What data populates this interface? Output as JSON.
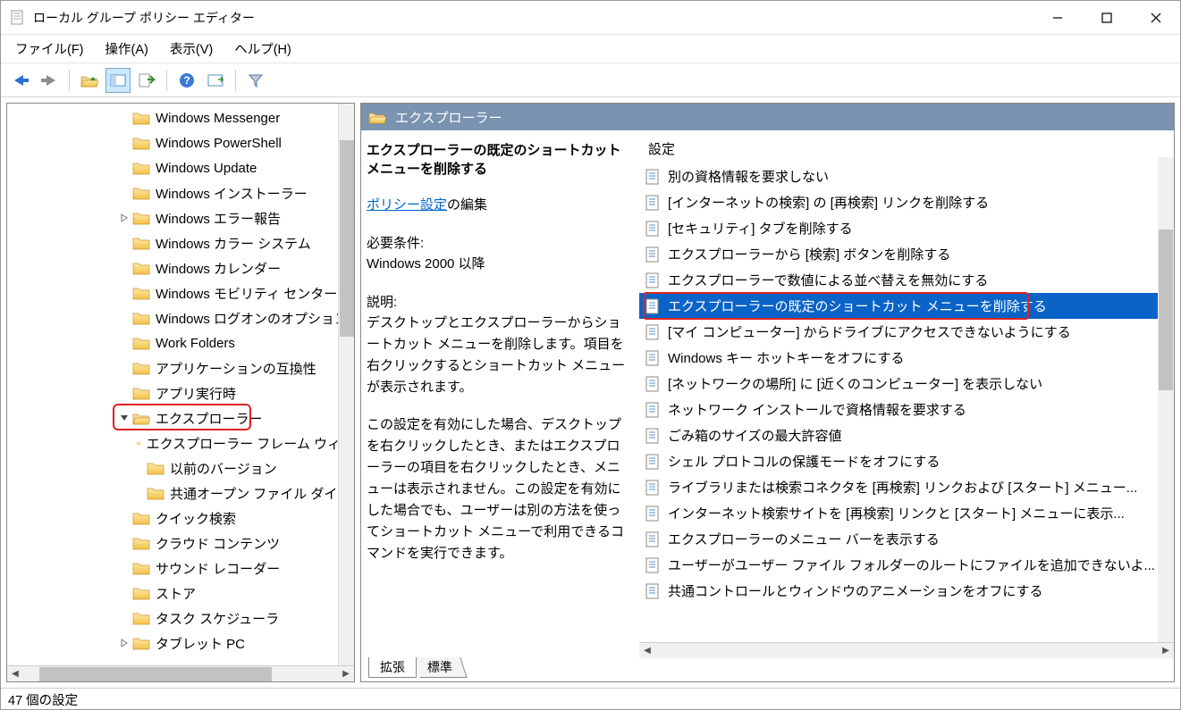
{
  "title": "ローカル グループ ポリシー エディター",
  "menubar": {
    "file": "ファイル(F)",
    "action": "操作(A)",
    "view": "表示(V)",
    "help": "ヘルプ(H)"
  },
  "tree": [
    {
      "level": 3,
      "exp": "",
      "label": "Windows Messenger"
    },
    {
      "level": 3,
      "exp": "",
      "label": "Windows PowerShell"
    },
    {
      "level": 3,
      "exp": "",
      "label": "Windows Update"
    },
    {
      "level": 3,
      "exp": "",
      "label": "Windows インストーラー"
    },
    {
      "level": 3,
      "exp": ">",
      "label": "Windows エラー報告"
    },
    {
      "level": 3,
      "exp": "",
      "label": "Windows カラー システム"
    },
    {
      "level": 3,
      "exp": "",
      "label": "Windows カレンダー"
    },
    {
      "level": 3,
      "exp": "",
      "label": "Windows モビリティ センター"
    },
    {
      "level": 3,
      "exp": "",
      "label": "Windows ログオンのオプション"
    },
    {
      "level": 3,
      "exp": "",
      "label": "Work Folders"
    },
    {
      "level": 3,
      "exp": "",
      "label": "アプリケーションの互換性"
    },
    {
      "level": 3,
      "exp": "",
      "label": "アプリ実行時"
    },
    {
      "level": 3,
      "exp": "v",
      "label": "エクスプローラー",
      "open": true,
      "selected": true
    },
    {
      "level": 4,
      "exp": "",
      "label": "エクスプローラー フレーム ウィン"
    },
    {
      "level": 4,
      "exp": "",
      "label": "以前のバージョン"
    },
    {
      "level": 4,
      "exp": "",
      "label": "共通オープン ファイル ダイア"
    },
    {
      "level": 3,
      "exp": "",
      "label": "クイック検索"
    },
    {
      "level": 3,
      "exp": "",
      "label": "クラウド コンテンツ"
    },
    {
      "level": 3,
      "exp": "",
      "label": "サウンド レコーダー"
    },
    {
      "level": 3,
      "exp": "",
      "label": "ストア"
    },
    {
      "level": 3,
      "exp": "",
      "label": "タスク スケジューラ"
    },
    {
      "level": 3,
      "exp": ">",
      "label": "タブレット PC"
    }
  ],
  "right": {
    "header": "エクスプローラー",
    "policy_title": "エクスプローラーの既定のショートカット メニューを削除する",
    "edit_link": "ポリシー設定",
    "edit_suffix": "の編集",
    "req_hdr": "必要条件:",
    "req": "Windows 2000 以降",
    "desc_hdr": "説明:",
    "desc": "デスクトップとエクスプローラーからショートカット メニューを削除します。項目を右クリックするとショートカット メニューが表示されます。",
    "desc2": "この設定を有効にした場合、デスクトップを右クリックしたとき、またはエクスプローラーの項目を右クリックしたとき、メニューは表示されません。この設定を有効にした場合でも、ユーザーは別の方法を使ってショートカット メニューで利用できるコマンドを実行できます。",
    "settings_hdr": "設定",
    "settings": [
      {
        "label": "別の資格情報を要求しない"
      },
      {
        "label": "[インターネットの検索] の [再検索] リンクを削除する"
      },
      {
        "label": "[セキュリティ] タブを削除する"
      },
      {
        "label": "エクスプローラーから [検索] ボタンを削除する"
      },
      {
        "label": "エクスプローラーで数値による並べ替えを無効にする"
      },
      {
        "label": "エクスプローラーの既定のショートカット メニューを削除する",
        "selected": true
      },
      {
        "label": "[マイ コンピューター] からドライブにアクセスできないようにする"
      },
      {
        "label": "Windows キー ホットキーをオフにする"
      },
      {
        "label": "[ネットワークの場所] に [近くのコンピューター] を表示しない"
      },
      {
        "label": "ネットワーク インストールで資格情報を要求する"
      },
      {
        "label": "ごみ箱のサイズの最大許容値"
      },
      {
        "label": "シェル プロトコルの保護モードをオフにする"
      },
      {
        "label": "ライブラリまたは検索コネクタを [再検索] リンクおよび [スタート] メニュー..."
      },
      {
        "label": "インターネット検索サイトを [再検索] リンクと [スタート] メニューに表示..."
      },
      {
        "label": "エクスプローラーのメニュー バーを表示する"
      },
      {
        "label": "ユーザーがユーザー ファイル フォルダーのルートにファイルを追加できないよ..."
      },
      {
        "label": "共通コントロールとウィンドウのアニメーションをオフにする"
      }
    ]
  },
  "tabs": {
    "extended": "拡張",
    "standard": "標準"
  },
  "status": "47 個の設定"
}
